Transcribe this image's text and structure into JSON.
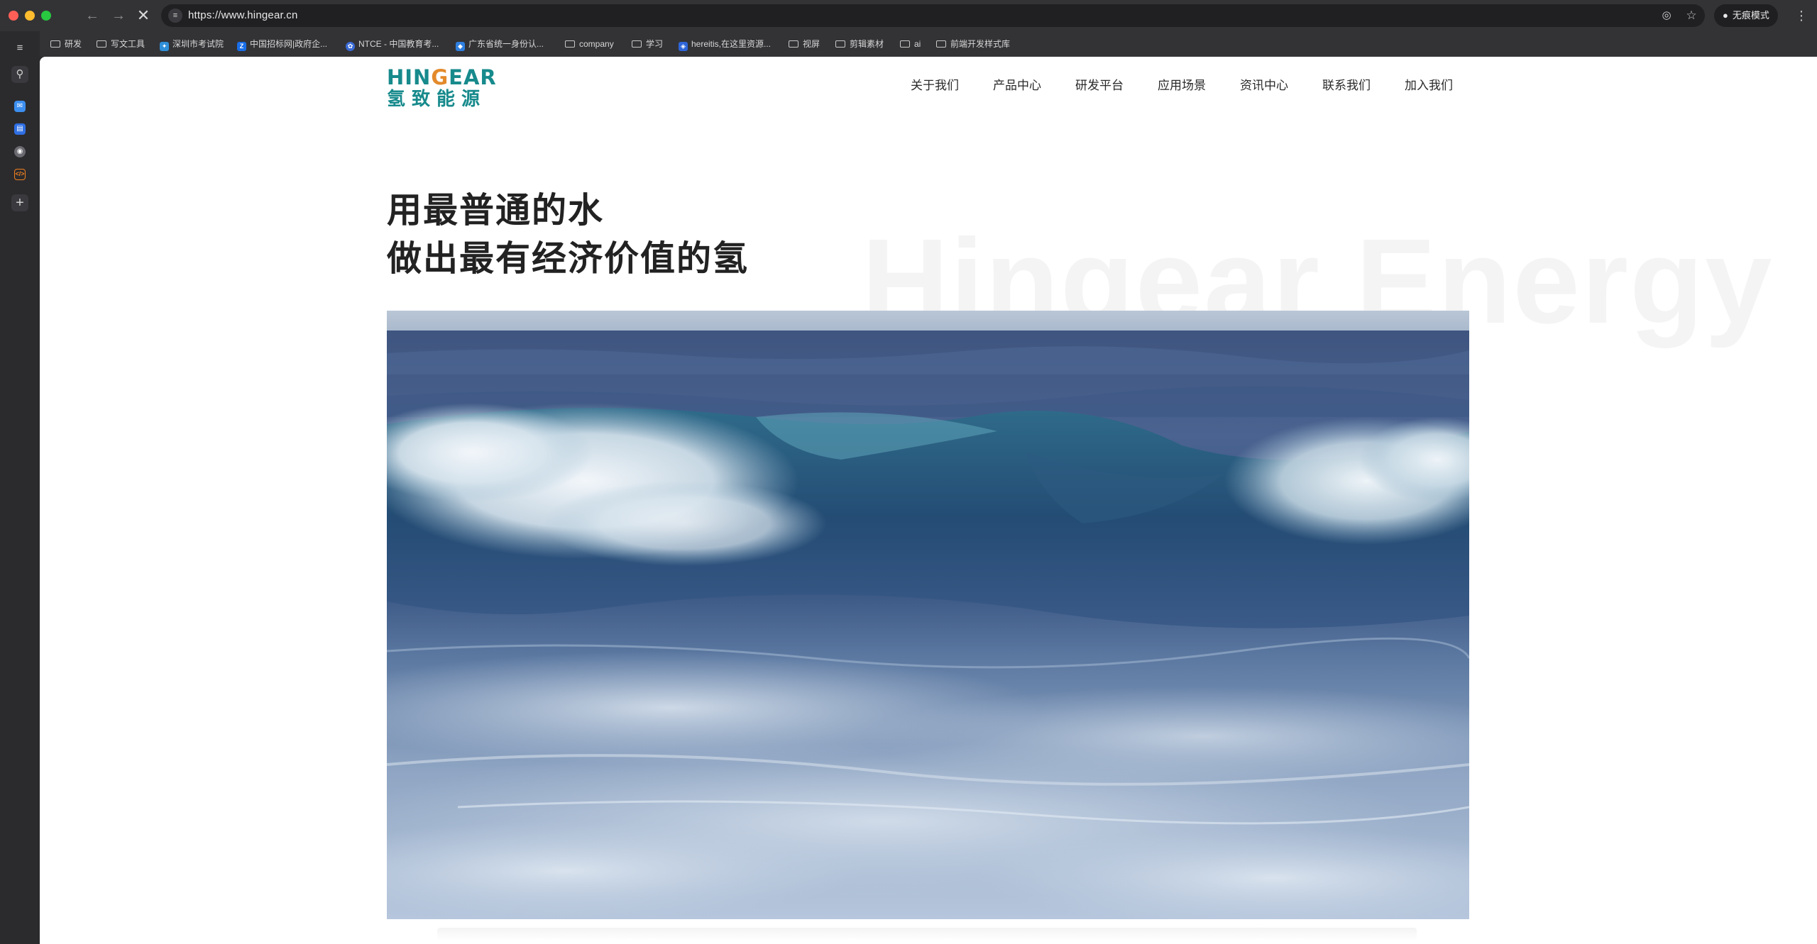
{
  "browser": {
    "url": "https://www.hingear.cn",
    "incognito_label": "无痕模式",
    "icons": {
      "back": "arrow-left",
      "forward": "arrow-right",
      "stop": "x-mark",
      "site_settings": "tune",
      "eye_off": "eye-slash",
      "bookmark_star": "star",
      "menu": "three-dots-vertical"
    }
  },
  "bookmarks": [
    {
      "label": "研发",
      "type": "folder"
    },
    {
      "label": "写文工具",
      "type": "folder"
    },
    {
      "label": "深圳市考试院",
      "type": "site",
      "color": "#2f8fd8"
    },
    {
      "label": "中国招标网|政府企...",
      "type": "site",
      "color": "#1a6ee8"
    },
    {
      "label": "NTCE - 中国教育考...",
      "type": "site",
      "color": "#3b6bd6"
    },
    {
      "label": "广东省统一身份认...",
      "type": "site",
      "color": "#2f7fe0"
    },
    {
      "label": "company",
      "type": "folder"
    },
    {
      "label": "学习",
      "type": "folder"
    },
    {
      "label": "hereitis,在这里资源...",
      "type": "site",
      "color": "#2e66d9"
    },
    {
      "label": "视屏",
      "type": "folder"
    },
    {
      "label": "剪辑素材",
      "type": "folder"
    },
    {
      "label": "ai",
      "type": "folder"
    },
    {
      "label": "前端开发样式库",
      "type": "folder"
    }
  ],
  "sidebar": {
    "icons": [
      "tab-list-icon",
      "tab-search-icon",
      "mail-favicon",
      "docs-favicon",
      "chrome-favicon",
      "code-favicon",
      "new-tab-plus-icon"
    ]
  },
  "page": {
    "logo_en_prefix": "HIN",
    "logo_en_o": "G",
    "logo_en_suffix": "EAR",
    "logo_cn": "氢致能源",
    "nav": [
      "关于我们",
      "产品中心",
      "研发平台",
      "应用场景",
      "资讯中心",
      "联系我们",
      "加入我们"
    ],
    "hero_line1": "用最普通的水",
    "hero_line2": "做出最有经济价值的氢",
    "watermark": "Hingear Energy",
    "hero_image": "ocean-wave-photo"
  }
}
